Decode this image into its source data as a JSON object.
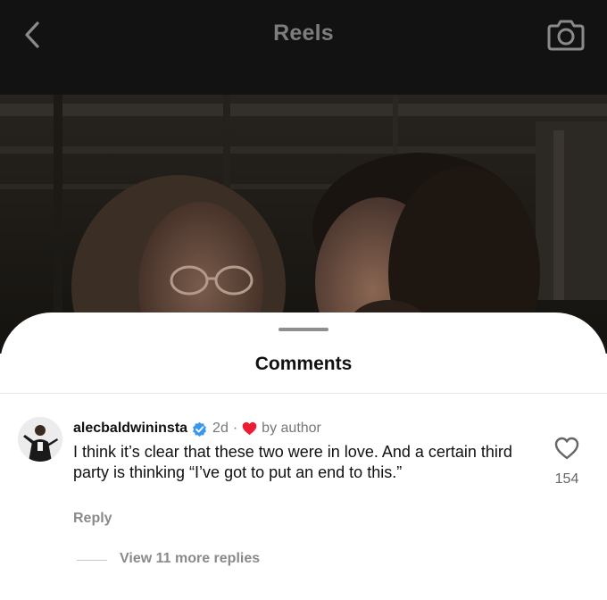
{
  "header": {
    "title": "Reels",
    "back_icon": "chevron-left-icon",
    "camera_icon": "camera-icon"
  },
  "sheet": {
    "title": "Comments"
  },
  "comment": {
    "username": "alecbaldwininsta",
    "verified_icon": "verified-badge-icon",
    "age": "2d",
    "separator": "·",
    "liked_by_author_icon": "heart-filled-icon",
    "liked_by": "by author",
    "text": "I think it’s clear that these two were in love. And a certain third party is thinking “I’ve got to put an end to this.”",
    "reply_label": "Reply",
    "like_icon": "heart-outline-icon",
    "like_count": "154",
    "view_replies": "View 11 more replies"
  },
  "colors": {
    "topbar_bg": "#121212",
    "verified_blue": "#3897f0",
    "heart_red": "#ed1c35",
    "secondary_text": "#777777"
  }
}
